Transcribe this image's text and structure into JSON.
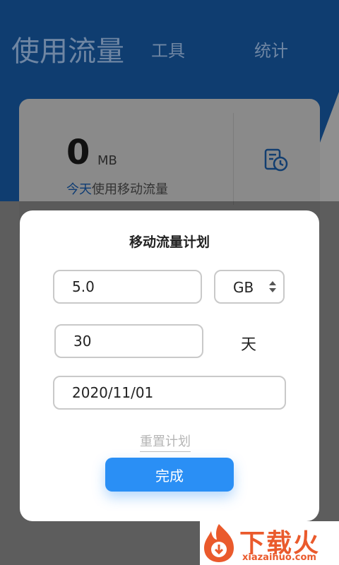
{
  "header": {
    "tabs": [
      "使用流量",
      "工具",
      "统计"
    ]
  },
  "summary": {
    "value": "0",
    "unit": "MB",
    "caption_highlight": "今天",
    "caption_rest": "使用移动流量",
    "history_icon": "history-clock-icon"
  },
  "dialog": {
    "title": "移动流量计划",
    "data_limit": "5.0",
    "unit": "GB",
    "days": "30",
    "days_suffix": "天",
    "start_date": "2020/11/01",
    "reset_label": "重置计划",
    "done_label": "完成"
  },
  "watermark": {
    "text": "下载火",
    "sub": "xiazaihuo.com"
  },
  "colors": {
    "header": "#0f3d70",
    "accent": "#2a8ff5",
    "watermark": "#ea5a2c"
  }
}
